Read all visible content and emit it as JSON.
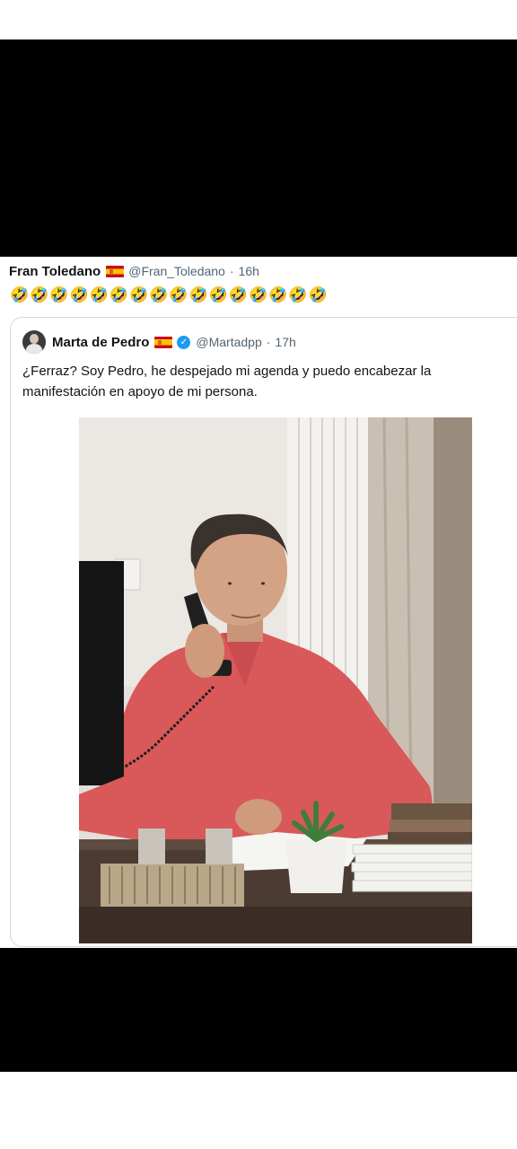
{
  "tweet": {
    "display_name": "Fran Toledano",
    "handle": "@Fran_Toledano",
    "separator": "·",
    "time": "16h",
    "emoji_text": "🤣🤣🤣🤣🤣🤣🤣🤣🤣🤣🤣🤣🤣🤣🤣🤣"
  },
  "quoted_tweet": {
    "display_name": "Marta de Pedro",
    "handle": "@Martadpp",
    "separator": "·",
    "time": "17h",
    "text": "¿Ferraz? Soy Pedro, he despejado mi agenda y puedo encabezar la manifestación en apoyo de mi persona.",
    "verified": true
  },
  "icons": {
    "flag": "spain-flag-icon",
    "verified": "verified-badge-icon",
    "avatar": "avatar-icon"
  },
  "colors": {
    "text_primary": "#0f1419",
    "text_secondary": "#536471",
    "verified_blue": "#1d9bf0",
    "border": "#cfd9de",
    "shirt": "#d9585a"
  }
}
